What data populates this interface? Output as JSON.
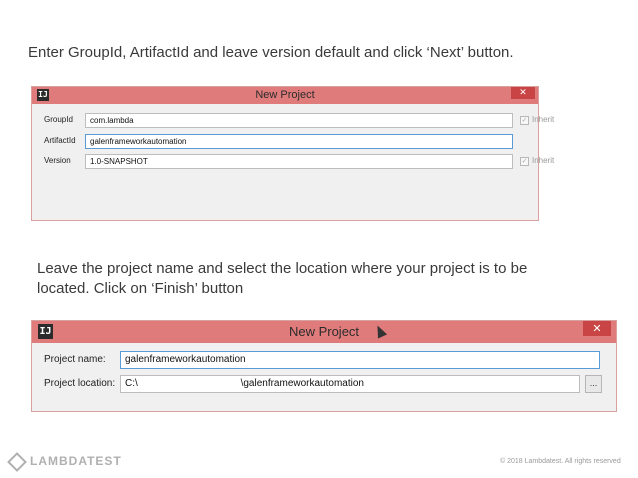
{
  "instruction1": "Enter GroupId, ArtifactId and leave version default and click ‘Next’ button.",
  "instruction2": "Leave the project name and select the location where your project is to be located. Click on ‘Finish’ button",
  "dialog1": {
    "title": "New Project",
    "icon": "intellij-app-icon",
    "icon_glyph": "IJ",
    "close_glyph": "✕",
    "fields": [
      {
        "label": "GroupId",
        "value": "com.lambda",
        "inherit_label": "Inherit",
        "has_inherit": true
      },
      {
        "label": "ArtifactId",
        "value": "galenframeworkautomation",
        "inherit_label": "",
        "has_inherit": false
      },
      {
        "label": "Version",
        "value": "1.0-SNAPSHOT",
        "inherit_label": "Inherit",
        "has_inherit": true
      }
    ],
    "check_glyph": "✓"
  },
  "dialog2": {
    "title": "New Project",
    "icon_glyph": "IJ",
    "close_glyph": "✕",
    "project_name_label": "Project name:",
    "project_name_value": "galenframeworkautomation",
    "project_location_label": "Project location:",
    "project_location_value": "C:\\                                     \\galenframeworkautomation",
    "browse_label": "..."
  },
  "footer": {
    "logo_text": "LAMBDATEST",
    "copyright": "© 2018 Lambdatest. All rights reserved"
  },
  "colors": {
    "titlebar": "#e07b7b",
    "close_button": "#c94545",
    "dialog_bg": "#f0f0f0",
    "focus_border": "#5a9bd5"
  }
}
